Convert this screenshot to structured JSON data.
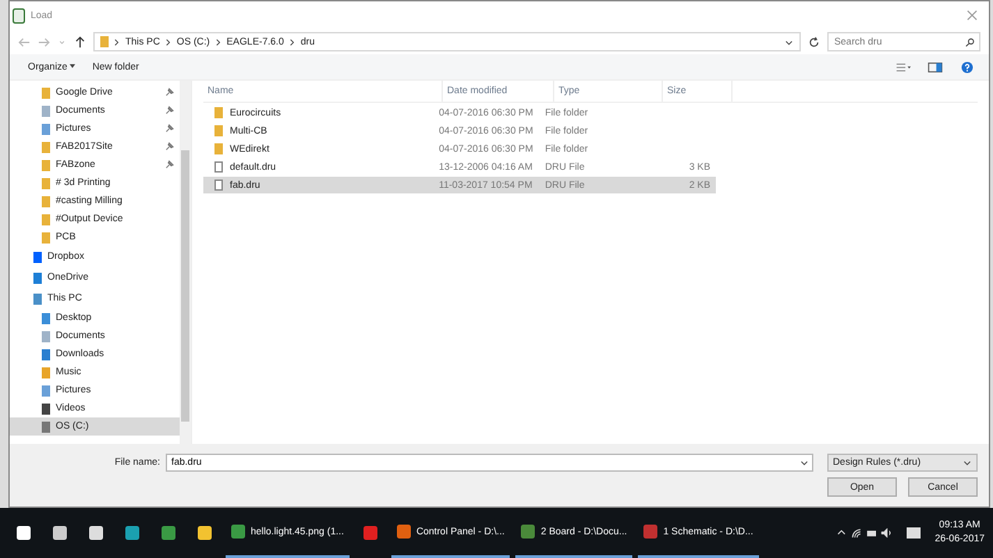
{
  "window": {
    "title": "Load"
  },
  "address": {
    "crumbs": [
      "This PC",
      "OS (C:)",
      "EAGLE-7.6.0",
      "dru"
    ],
    "search_placeholder": "Search dru"
  },
  "toolbar": {
    "organize": "Organize",
    "new_folder": "New folder"
  },
  "sidebar": [
    {
      "label": "Google Drive",
      "kind": "folder",
      "pinned": true,
      "selected": false
    },
    {
      "label": "Documents",
      "kind": "docs",
      "pinned": true,
      "selected": false
    },
    {
      "label": "Pictures",
      "kind": "pics",
      "pinned": true,
      "selected": false
    },
    {
      "label": "FAB2017Site",
      "kind": "folder",
      "pinned": true,
      "selected": false
    },
    {
      "label": "FABzone",
      "kind": "folder",
      "pinned": true,
      "selected": false
    },
    {
      "label": "# 3d Printing",
      "kind": "folder",
      "pinned": false,
      "selected": false
    },
    {
      "label": "#casting Milling",
      "kind": "folder",
      "pinned": false,
      "selected": false
    },
    {
      "label": "#Output Device",
      "kind": "folder",
      "pinned": false,
      "selected": false
    },
    {
      "label": "PCB",
      "kind": "folder",
      "pinned": false,
      "selected": false
    },
    {
      "label": "Dropbox",
      "kind": "dropbox",
      "pinned": false,
      "selected": false
    },
    {
      "label": "OneDrive",
      "kind": "cloud",
      "pinned": false,
      "selected": false
    },
    {
      "label": "This PC",
      "kind": "pc",
      "pinned": false,
      "selected": false
    },
    {
      "label": "Desktop",
      "kind": "desktop",
      "pinned": false,
      "selected": false
    },
    {
      "label": "Documents",
      "kind": "docs",
      "pinned": false,
      "selected": false
    },
    {
      "label": "Downloads",
      "kind": "downloads",
      "pinned": false,
      "selected": false
    },
    {
      "label": "Music",
      "kind": "music",
      "pinned": false,
      "selected": false
    },
    {
      "label": "Pictures",
      "kind": "pics",
      "pinned": false,
      "selected": false
    },
    {
      "label": "Videos",
      "kind": "videos",
      "pinned": false,
      "selected": false
    },
    {
      "label": "OS (C:)",
      "kind": "drive",
      "pinned": false,
      "selected": true
    }
  ],
  "columns": [
    "Name",
    "Date modified",
    "Type",
    "Size"
  ],
  "files": [
    {
      "name": "Eurocircuits",
      "date": "04-07-2016 06:30 PM",
      "type": "File folder",
      "kind": "folder",
      "selected": false
    },
    {
      "name": "Multi-CB",
      "date": "04-07-2016 06:30 PM",
      "type": "File folder",
      "kind": "folder",
      "selected": false
    },
    {
      "name": "WEdirekt",
      "date": "04-07-2016 06:30 PM",
      "type": "File folder",
      "kind": "folder",
      "selected": false
    },
    {
      "name": "default.dru",
      "date": "13-12-2006 04:16 AM",
      "type": "DRU File",
      "size": "3 KB",
      "kind": "file",
      "selected": false
    },
    {
      "name": "fab.dru",
      "date": "11-03-2017 10:54 PM",
      "type": "DRU File",
      "size": "2 KB",
      "kind": "file",
      "selected": true
    }
  ],
  "bottom": {
    "file_name_label": "File name:",
    "file_name": "fab.dru",
    "filter": "Design Rules (*.dru)",
    "open": "Open",
    "cancel": "Cancel"
  },
  "taskbar": {
    "apps": [
      {
        "kind": "windows"
      },
      {
        "kind": "taskview"
      },
      {
        "kind": "p"
      },
      {
        "kind": "arduino"
      },
      {
        "kind": "chrome"
      },
      {
        "kind": "explorer"
      },
      {
        "kind": "chrome",
        "label": "hello.light.45.png (1..."
      },
      {
        "kind": "red"
      },
      {
        "kind": "orange",
        "label": "Control Panel - D:\\..."
      },
      {
        "kind": "board",
        "label": "2 Board - D:\\Docu..."
      },
      {
        "kind": "schematic",
        "label": "1 Schematic - D:\\D..."
      }
    ],
    "time": "09:13 AM",
    "date": "26-06-2017"
  }
}
